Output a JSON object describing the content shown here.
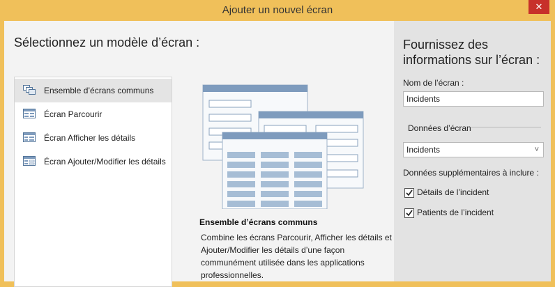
{
  "window": {
    "title": "Ajouter un nouvel écran",
    "close_glyph": "✕"
  },
  "left": {
    "title": "Sélectionnez un modèle d’écran :",
    "templates": [
      {
        "label": "Ensemble d’écrans communs",
        "icon": "screen-set-icon",
        "selected": true
      },
      {
        "label": "Écran Parcourir",
        "icon": "browse-screen-icon",
        "selected": false
      },
      {
        "label": "Écran Afficher les détails",
        "icon": "details-screen-icon",
        "selected": false
      },
      {
        "label": "Écran Ajouter/Modifier les détails",
        "icon": "edit-details-screen-icon",
        "selected": false
      }
    ],
    "description": {
      "title": "Ensemble d’écrans communs",
      "text": "Combine les écrans Parcourir, Afficher les détails et Ajouter/Modifier les détails d’une façon communément utilisée dans les applications professionnelles."
    }
  },
  "right": {
    "title": "Fournissez des informations sur l’écran :",
    "screen_name_label": "Nom de l’écran :",
    "screen_name_value": "Incidents",
    "screen_data_label": "Données d’écran",
    "screen_data_value": "Incidents",
    "additional_label": "Données supplémentaires à inclure :",
    "checkboxes": [
      {
        "label": "Détails de l’incident",
        "checked": true
      },
      {
        "label": "Patients de l’incident",
        "checked": true
      }
    ]
  },
  "colors": {
    "title_bar": "#f0c05a",
    "close_button": "#c7302a",
    "left_panel": "#f3f3f3",
    "right_panel": "#e3e3e3",
    "preview_header": "#7e9bbd",
    "preview_cell": "#a6bdd5"
  }
}
